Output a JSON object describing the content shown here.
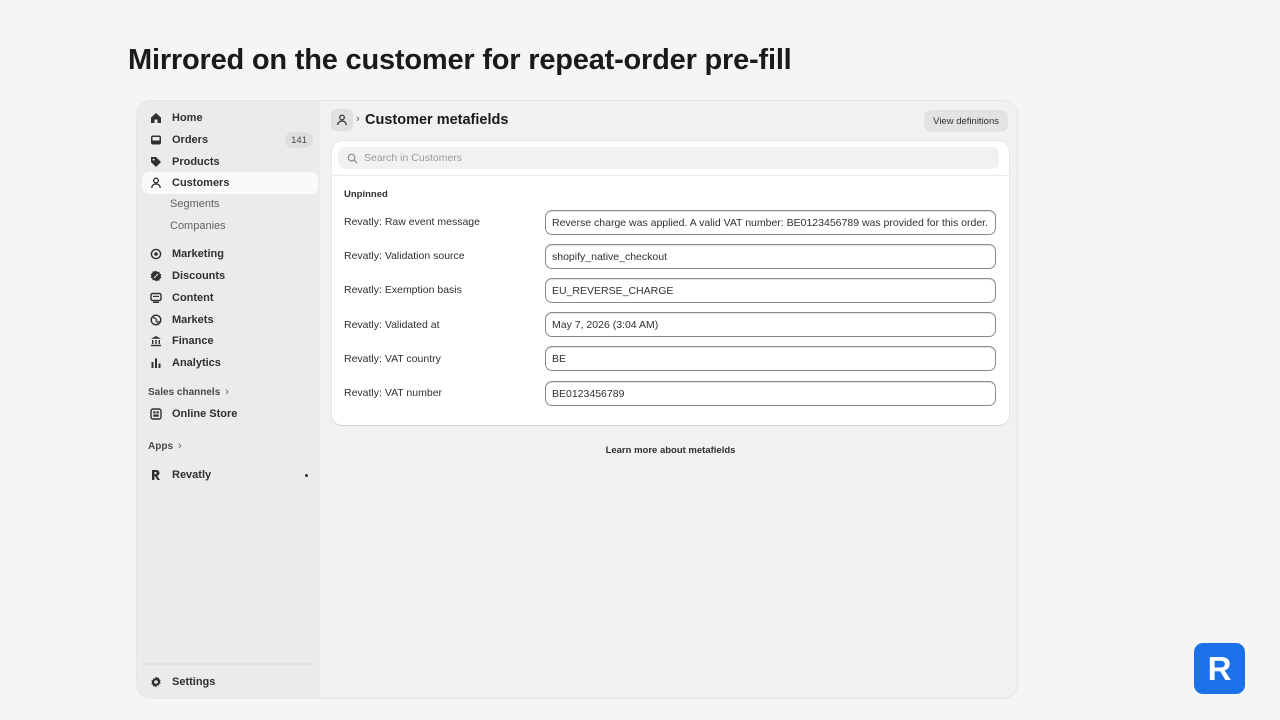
{
  "headline": "Mirrored on the customer for repeat-order pre-fill",
  "sidebar": {
    "items": [
      {
        "label": "Home",
        "icon": "home-icon"
      },
      {
        "label": "Orders",
        "icon": "inbox-icon",
        "badge": "141"
      },
      {
        "label": "Products",
        "icon": "tag-icon"
      },
      {
        "label": "Customers",
        "icon": "person-icon",
        "active": true
      },
      {
        "label": "Marketing",
        "icon": "target-icon"
      },
      {
        "label": "Discounts",
        "icon": "discount-icon"
      },
      {
        "label": "Content",
        "icon": "content-icon"
      },
      {
        "label": "Markets",
        "icon": "globe-icon"
      },
      {
        "label": "Finance",
        "icon": "bank-icon"
      },
      {
        "label": "Analytics",
        "icon": "bar-chart-icon"
      }
    ],
    "customer_subitems": [
      "Segments",
      "Companies"
    ],
    "sales_channels_label": "Sales channels",
    "online_store_label": "Online Store",
    "apps_label": "Apps",
    "revatly_label": "Revatly",
    "settings_label": "Settings"
  },
  "header": {
    "title": "Customer metafields",
    "view_definitions_label": "View definitions"
  },
  "card": {
    "search_placeholder": "Search in Customers",
    "section_label": "Unpinned",
    "rows": [
      {
        "label": "Revatly: Raw event message",
        "value": "Reverse charge was applied. A valid VAT number: BE0123456789 was provided for this order."
      },
      {
        "label": "Revatly: Validation source",
        "value": "shopify_native_checkout"
      },
      {
        "label": "Revatly: Exemption basis",
        "value": "EU_REVERSE_CHARGE"
      },
      {
        "label": "Revatly: Validated at",
        "value": "May 7, 2026 (3:04 AM)"
      },
      {
        "label": "Revatly: VAT country",
        "value": "BE"
      },
      {
        "label": "Revatly: VAT number",
        "value": "BE0123456789"
      }
    ]
  },
  "learn_more_label": "Learn more about metafields",
  "brand_logo_letter": "R",
  "colors": {
    "brand": "#1b72e8",
    "sidebar_bg": "#ebebeb",
    "page_bg": "#f5f5f5"
  }
}
